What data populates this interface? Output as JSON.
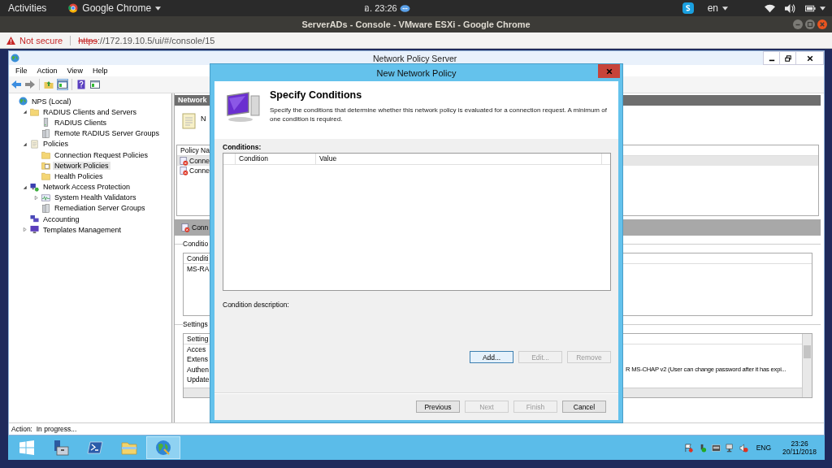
{
  "top_bar": {
    "activities": "Activities",
    "app": "Google Chrome",
    "clock": "อ. 23:26",
    "language": "en"
  },
  "browser": {
    "title": "ServerADs - Console - VMware ESXi - Google Chrome",
    "security": "Not secure",
    "url_scheme": "https",
    "url_rest": "://172.19.10.5/ui/#/console/15"
  },
  "mmc": {
    "title": "Network Policy Server",
    "menu": [
      "File",
      "Action",
      "View",
      "Help"
    ],
    "tree": [
      {
        "label": "NPS (Local)",
        "selected": false,
        "children": [
          {
            "label": "RADIUS Clients and Servers",
            "selected": false,
            "expanded": true,
            "children": [
              {
                "label": "RADIUS Clients",
                "selected": false
              },
              {
                "label": "Remote RADIUS Server Groups",
                "selected": false
              }
            ]
          },
          {
            "label": "Policies",
            "selected": false,
            "expanded": true,
            "children": [
              {
                "label": "Connection Request Policies",
                "selected": false
              },
              {
                "label": "Network Policies",
                "selected": true
              },
              {
                "label": "Health Policies",
                "selected": false
              }
            ]
          },
          {
            "label": "Network Access Protection",
            "selected": false,
            "expanded": true,
            "children": [
              {
                "label": "System Health Validators",
                "selected": false,
                "expanded": false
              },
              {
                "label": "Remediation Server Groups",
                "selected": false
              }
            ]
          },
          {
            "label": "Accounting",
            "selected": false
          },
          {
            "label": "Templates Management",
            "selected": false,
            "expanded": false
          }
        ]
      }
    ],
    "details": {
      "header": "Network",
      "intro": "N",
      "list_header": "Policy Na",
      "policies": [
        {
          "name": "Conne",
          "selected": true
        },
        {
          "name": "Conne",
          "selected": false
        }
      ],
      "selected_title": "Conn",
      "conditions_label": "Conditio",
      "conditions_header": "Conditi",
      "conditions": [
        "MS-RA"
      ],
      "settings_label": "Settings",
      "settings_header": "Setting",
      "settings": [
        {
          "name": "Acces"
        },
        {
          "name": "Extens"
        },
        {
          "name": "Authen",
          "value": "R MS-CHAP v2 (User can change password after it has expi..."
        },
        {
          "name": "Update"
        }
      ]
    },
    "status": "Action:  In progress..."
  },
  "dialog": {
    "title": "New Network Policy",
    "heading": "Specify Conditions",
    "description": "Specify the conditions that determine whether this network policy is evaluated for a connection request. A minimum of one condition is required.",
    "conditions_label": "Conditions:",
    "columns": [
      "Condition",
      "Value"
    ],
    "description_label": "Condition description:",
    "actions": [
      {
        "label": "Add...",
        "disabled": false,
        "focused": true
      },
      {
        "label": "Edit...",
        "disabled": true,
        "focused": false
      },
      {
        "label": "Remove",
        "disabled": true,
        "focused": false
      }
    ],
    "nav": [
      {
        "label": "Previous",
        "disabled": false
      },
      {
        "label": "Next",
        "disabled": true
      },
      {
        "label": "Finish",
        "disabled": true
      },
      {
        "label": "Cancel",
        "disabled": false
      }
    ]
  },
  "taskbar": {
    "apps": [
      {
        "kind": "start",
        "selected": false
      },
      {
        "kind": "server-manager",
        "selected": false
      },
      {
        "kind": "powershell",
        "selected": false
      },
      {
        "kind": "explorer",
        "selected": false
      },
      {
        "kind": "nps",
        "selected": true
      }
    ],
    "language": "ENG",
    "time": "23:26",
    "date": "20/11/2018"
  }
}
